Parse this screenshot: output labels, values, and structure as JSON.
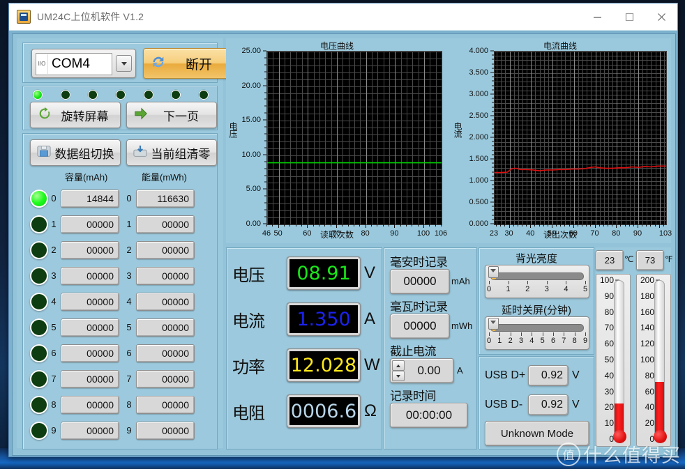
{
  "window": {
    "title": "UM24C上位机软件 V1.2",
    "icon": "app-icon",
    "controls": {
      "minimize": "—",
      "maximize": "☐",
      "close": "✕"
    }
  },
  "connection": {
    "port_value": "COM4",
    "port_glyph": "I/O",
    "disconnect_label": "断开",
    "disconnect_icon": "refresh-icon",
    "leds": [
      true,
      false,
      false,
      false,
      false,
      false,
      false
    ]
  },
  "device_buttons": {
    "rotate_label": "旋转屏幕",
    "rotate_icon": "rotate-arrow-icon",
    "next_page_label": "下一页",
    "next_page_icon": "arrow-right-icon",
    "group_switch_label": "数据组切换",
    "group_switch_icon": "folder-icon",
    "group_clear_label": "当前组清零",
    "group_clear_icon": "save-down-icon"
  },
  "data_groups": {
    "capacity_header": "容量(mAh)",
    "energy_header": "能量(mWh)",
    "rows": [
      {
        "index": "0",
        "active": true,
        "capacity": "14844",
        "energy": "116630"
      },
      {
        "index": "1",
        "active": false,
        "capacity": "00000",
        "energy": "00000"
      },
      {
        "index": "2",
        "active": false,
        "capacity": "00000",
        "energy": "00000"
      },
      {
        "index": "3",
        "active": false,
        "capacity": "00000",
        "energy": "00000"
      },
      {
        "index": "4",
        "active": false,
        "capacity": "00000",
        "energy": "00000"
      },
      {
        "index": "5",
        "active": false,
        "capacity": "00000",
        "energy": "00000"
      },
      {
        "index": "6",
        "active": false,
        "capacity": "00000",
        "energy": "00000"
      },
      {
        "index": "7",
        "active": false,
        "capacity": "00000",
        "energy": "00000"
      },
      {
        "index": "8",
        "active": false,
        "capacity": "00000",
        "energy": "00000"
      },
      {
        "index": "9",
        "active": false,
        "capacity": "00000",
        "energy": "00000"
      }
    ]
  },
  "chart_data": [
    {
      "type": "line",
      "name": "voltage-chart",
      "title": "电压曲线",
      "xlabel": "读取次数",
      "ylabel": "电压",
      "ylim": [
        0,
        25
      ],
      "xlim": [
        46,
        106
      ],
      "yticks": [
        "0.00",
        "5.00",
        "10.00",
        "15.00",
        "20.00",
        "25.00"
      ],
      "ytick_values": [
        0,
        5,
        10,
        15,
        20,
        25
      ],
      "xticks": [
        "46",
        "50",
        "60",
        "70",
        "80",
        "90",
        "100",
        "106"
      ],
      "xtick_values": [
        46,
        50,
        60,
        70,
        80,
        90,
        100,
        106
      ],
      "grid": true,
      "series_color": "#00d400",
      "x": [
        46,
        50,
        55,
        60,
        65,
        70,
        75,
        80,
        85,
        90,
        95,
        100,
        106
      ],
      "values": [
        8.91,
        8.91,
        8.91,
        8.91,
        8.91,
        8.91,
        8.91,
        8.91,
        8.91,
        8.91,
        8.91,
        8.91,
        8.91
      ]
    },
    {
      "type": "line",
      "name": "current-chart",
      "title": "电流曲线",
      "xlabel": "读出次数",
      "ylabel": "电流",
      "ylim": [
        0,
        4
      ],
      "xlim": [
        23,
        103
      ],
      "yticks": [
        "0.000",
        "0.500",
        "1.000",
        "1.500",
        "2.000",
        "2.500",
        "3.000",
        "3.500",
        "4.000"
      ],
      "ytick_values": [
        0,
        0.5,
        1,
        1.5,
        2,
        2.5,
        3,
        3.5,
        4
      ],
      "xticks": [
        "23",
        "30",
        "40",
        "50",
        "60",
        "70",
        "80",
        "90",
        "103"
      ],
      "xtick_values": [
        23,
        30,
        40,
        50,
        60,
        70,
        80,
        90,
        103
      ],
      "grid": true,
      "series_color": "#e01010",
      "x": [
        23,
        26,
        29,
        31,
        33,
        35,
        38,
        41,
        44,
        47,
        50,
        53,
        56,
        59,
        62,
        65,
        68,
        70,
        72,
        75,
        78,
        81,
        84,
        87,
        90,
        93,
        96,
        99,
        103
      ],
      "values": [
        1.2,
        1.2,
        1.21,
        1.29,
        1.3,
        1.27,
        1.27,
        1.26,
        1.24,
        1.26,
        1.26,
        1.27,
        1.27,
        1.28,
        1.28,
        1.29,
        1.32,
        1.33,
        1.31,
        1.3,
        1.3,
        1.31,
        1.31,
        1.33,
        1.32,
        1.34,
        1.33,
        1.35,
        1.35
      ]
    }
  ],
  "readouts": [
    {
      "label": "电压",
      "value": "08.91",
      "unit": "V",
      "color": "#19e619"
    },
    {
      "label": "电流",
      "value": "1.350",
      "unit": "A",
      "color": "#1b22ef"
    },
    {
      "label": "功率",
      "value": "12.028",
      "unit": "W",
      "color": "#ffe81a"
    },
    {
      "label": "电阻",
      "value": "0006.6",
      "unit": "Ω",
      "color": "#b8d4e8"
    }
  ],
  "record": {
    "mah_title": "毫安时记录",
    "mah_value": "00000",
    "mah_unit": "mAh",
    "mwh_title": "毫瓦时记录",
    "mwh_value": "00000",
    "mwh_unit": "mWh",
    "cutoff_title": "截止电流",
    "cutoff_value": "0.00",
    "cutoff_unit": "A",
    "time_title": "记录时间",
    "time_value": "00:00:00"
  },
  "settings": {
    "backlight_title": "背光亮度",
    "backlight_value": 0,
    "backlight_ticks": [
      "0",
      "1",
      "2",
      "3",
      "4",
      "5"
    ],
    "sleep_title": "延时关屏(分钟)",
    "sleep_value": 0,
    "sleep_ticks": [
      "0",
      "1",
      "2",
      "3",
      "4",
      "5",
      "6",
      "7",
      "8",
      "9"
    ]
  },
  "usb": {
    "dplus_label": "USB D+",
    "dplus_value": "0.92",
    "dplus_unit": "V",
    "dminus_label": "USB D-",
    "dminus_value": "0.92",
    "dminus_unit": "V",
    "mode_value": "Unknown Mode"
  },
  "temperature": {
    "celsius_value": "23",
    "celsius_unit": "℃",
    "celsius_ticks": [
      "100",
      "90",
      "80",
      "70",
      "60",
      "50",
      "40",
      "30",
      "20",
      "10",
      "0"
    ],
    "celsius_max": 100,
    "fahrenheit_value": "73",
    "fahrenheit_unit": "℉",
    "fahrenheit_ticks": [
      "200",
      "180",
      "160",
      "140",
      "120",
      "100",
      "80",
      "60",
      "40",
      "20",
      "0"
    ],
    "fahrenheit_max": 200
  },
  "watermark": {
    "logo": "值",
    "text": "什么值得买"
  }
}
